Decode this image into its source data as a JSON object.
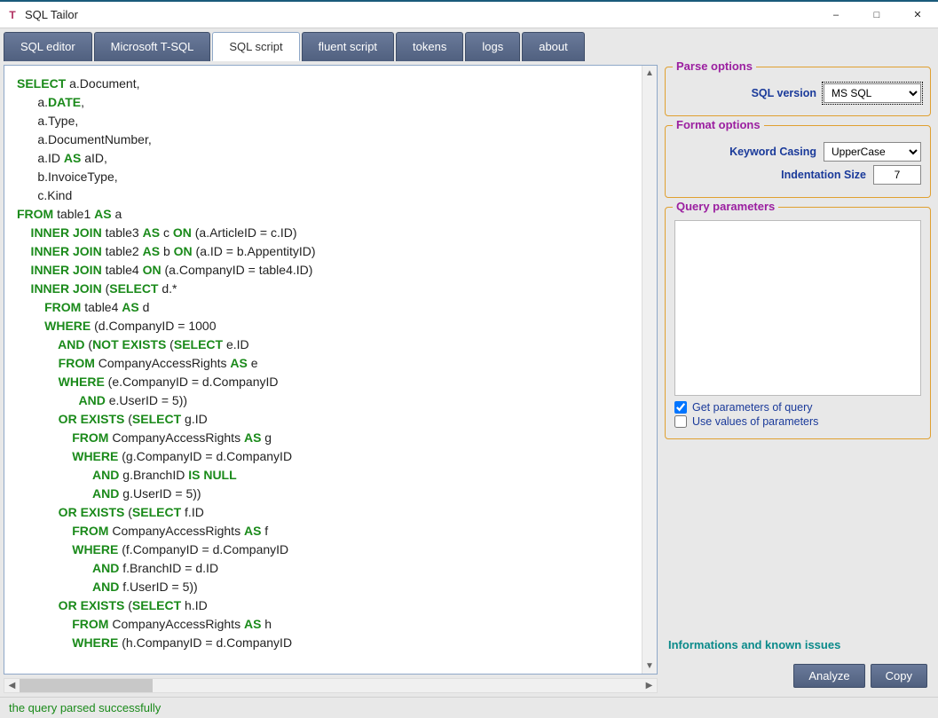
{
  "window": {
    "title": "SQL Tailor"
  },
  "tabs": [
    {
      "label": "SQL editor"
    },
    {
      "label": "Microsoft T-SQL"
    },
    {
      "label": "SQL script"
    },
    {
      "label": "fluent script"
    },
    {
      "label": "tokens"
    },
    {
      "label": "logs"
    },
    {
      "label": "about"
    }
  ],
  "active_tab_index": 2,
  "editor_lines": [
    [
      {
        "t": "SELECT",
        "k": true
      },
      {
        "t": " a.Document,",
        "k": false
      }
    ],
    [
      {
        "t": "      a.",
        "k": false
      },
      {
        "t": "DATE",
        "k": true
      },
      {
        "t": ",",
        "k": false
      }
    ],
    [
      {
        "t": "      a.Type,",
        "k": false
      }
    ],
    [
      {
        "t": "      a.DocumentNumber,",
        "k": false
      }
    ],
    [
      {
        "t": "      a.ID ",
        "k": false
      },
      {
        "t": "AS",
        "k": true
      },
      {
        "t": " aID,",
        "k": false
      }
    ],
    [
      {
        "t": "      b.InvoiceType,",
        "k": false
      }
    ],
    [
      {
        "t": "      c.Kind",
        "k": false
      }
    ],
    [
      {
        "t": "FROM",
        "k": true
      },
      {
        "t": " table1 ",
        "k": false
      },
      {
        "t": "AS",
        "k": true
      },
      {
        "t": " a",
        "k": false
      }
    ],
    [
      {
        "t": "    INNER JOIN",
        "k": true
      },
      {
        "t": " table3 ",
        "k": false
      },
      {
        "t": "AS",
        "k": true
      },
      {
        "t": " c ",
        "k": false
      },
      {
        "t": "ON",
        "k": true
      },
      {
        "t": " (a.ArticleID = c.ID)",
        "k": false
      }
    ],
    [
      {
        "t": "    INNER JOIN",
        "k": true
      },
      {
        "t": " table2 ",
        "k": false
      },
      {
        "t": "AS",
        "k": true
      },
      {
        "t": " b ",
        "k": false
      },
      {
        "t": "ON",
        "k": true
      },
      {
        "t": " (a.ID = b.AppentityID)",
        "k": false
      }
    ],
    [
      {
        "t": "    INNER JOIN",
        "k": true
      },
      {
        "t": " table4 ",
        "k": false
      },
      {
        "t": "ON",
        "k": true
      },
      {
        "t": " (a.CompanyID = table4.ID)",
        "k": false
      }
    ],
    [
      {
        "t": "    INNER JOIN",
        "k": true
      },
      {
        "t": " (",
        "k": false
      },
      {
        "t": "SELECT",
        "k": true
      },
      {
        "t": " d.*",
        "k": false
      }
    ],
    [
      {
        "t": "        FROM",
        "k": true
      },
      {
        "t": " table4 ",
        "k": false
      },
      {
        "t": "AS",
        "k": true
      },
      {
        "t": " d",
        "k": false
      }
    ],
    [
      {
        "t": "        WHERE",
        "k": true
      },
      {
        "t": " (d.CompanyID = 1000",
        "k": false
      }
    ],
    [
      {
        "t": "            AND",
        "k": true
      },
      {
        "t": " (",
        "k": false
      },
      {
        "t": "NOT EXISTS",
        "k": true
      },
      {
        "t": " (",
        "k": false
      },
      {
        "t": "SELECT",
        "k": true
      },
      {
        "t": " e.ID",
        "k": false
      }
    ],
    [
      {
        "t": "            FROM",
        "k": true
      },
      {
        "t": " CompanyAccessRights ",
        "k": false
      },
      {
        "t": "AS",
        "k": true
      },
      {
        "t": " e",
        "k": false
      }
    ],
    [
      {
        "t": "            WHERE",
        "k": true
      },
      {
        "t": " (e.CompanyID = d.CompanyID",
        "k": false
      }
    ],
    [
      {
        "t": "                  AND",
        "k": true
      },
      {
        "t": " e.UserID = 5))",
        "k": false
      }
    ],
    [
      {
        "t": "            OR EXISTS",
        "k": true
      },
      {
        "t": " (",
        "k": false
      },
      {
        "t": "SELECT",
        "k": true
      },
      {
        "t": " g.ID",
        "k": false
      }
    ],
    [
      {
        "t": "                FROM",
        "k": true
      },
      {
        "t": " CompanyAccessRights ",
        "k": false
      },
      {
        "t": "AS",
        "k": true
      },
      {
        "t": " g",
        "k": false
      }
    ],
    [
      {
        "t": "                WHERE",
        "k": true
      },
      {
        "t": " (g.CompanyID = d.CompanyID",
        "k": false
      }
    ],
    [
      {
        "t": "                      AND",
        "k": true
      },
      {
        "t": " g.BranchID ",
        "k": false
      },
      {
        "t": "IS NULL",
        "k": true
      }
    ],
    [
      {
        "t": "                      AND",
        "k": true
      },
      {
        "t": " g.UserID = 5))",
        "k": false
      }
    ],
    [
      {
        "t": "            OR EXISTS",
        "k": true
      },
      {
        "t": " (",
        "k": false
      },
      {
        "t": "SELECT",
        "k": true
      },
      {
        "t": " f.ID",
        "k": false
      }
    ],
    [
      {
        "t": "                FROM",
        "k": true
      },
      {
        "t": " CompanyAccessRights ",
        "k": false
      },
      {
        "t": "AS",
        "k": true
      },
      {
        "t": " f",
        "k": false
      }
    ],
    [
      {
        "t": "                WHERE",
        "k": true
      },
      {
        "t": " (f.CompanyID = d.CompanyID",
        "k": false
      }
    ],
    [
      {
        "t": "                      AND",
        "k": true
      },
      {
        "t": " f.BranchID = d.ID",
        "k": false
      }
    ],
    [
      {
        "t": "                      AND",
        "k": true
      },
      {
        "t": " f.UserID = 5))",
        "k": false
      }
    ],
    [
      {
        "t": "            OR EXISTS",
        "k": true
      },
      {
        "t": " (",
        "k": false
      },
      {
        "t": "SELECT",
        "k": true
      },
      {
        "t": " h.ID",
        "k": false
      }
    ],
    [
      {
        "t": "                FROM",
        "k": true
      },
      {
        "t": " CompanyAccessRights ",
        "k": false
      },
      {
        "t": "AS",
        "k": true
      },
      {
        "t": " h",
        "k": false
      }
    ],
    [
      {
        "t": "                WHERE",
        "k": true
      },
      {
        "t": " (h.CompanyID = d.CompanyID",
        "k": false
      }
    ]
  ],
  "parse_options": {
    "title": "Parse options",
    "sql_version_label": "SQL version",
    "sql_version_value": "MS SQL"
  },
  "format_options": {
    "title": "Format options",
    "keyword_casing_label": "Keyword Casing",
    "keyword_casing_value": "UpperCase",
    "indentation_label": "Indentation Size",
    "indentation_value": "7"
  },
  "query_params": {
    "title": "Query parameters",
    "get_params_label": "Get parameters of query",
    "get_params_checked": true,
    "use_values_label": "Use values of parameters",
    "use_values_checked": false
  },
  "info_link": "Informations and known issues",
  "buttons": {
    "analyze": "Analyze",
    "copy": "Copy"
  },
  "status": "the query parsed successfully"
}
